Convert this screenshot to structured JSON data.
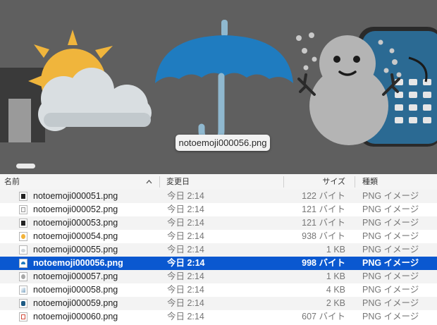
{
  "preview": {
    "caption": "notoemoji000056.png"
  },
  "columns": {
    "name": "名前",
    "date": "変更日",
    "size": "サイズ",
    "kind": "種類"
  },
  "files": [
    {
      "name": "notoemoji000051.png",
      "date": "今日 2:14",
      "size": "122 バイト",
      "kind": "PNG イメージ",
      "icon": "black-square-icon",
      "icon_color": "#222222"
    },
    {
      "name": "notoemoji000052.png",
      "date": "今日 2:14",
      "size": "121 バイト",
      "kind": "PNG イメージ",
      "icon": "white-square-icon",
      "icon_color": "#f4f4f4"
    },
    {
      "name": "notoemoji000053.png",
      "date": "今日 2:14",
      "size": "121 バイト",
      "kind": "PNG イメージ",
      "icon": "black-square-icon",
      "icon_color": "#222222"
    },
    {
      "name": "notoemoji000054.png",
      "date": "今日 2:14",
      "size": "938 バイト",
      "kind": "PNG イメージ",
      "icon": "sun-icon",
      "icon_color": "#f2b33a"
    },
    {
      "name": "notoemoji000055.png",
      "date": "今日 2:14",
      "size": "1 KB",
      "kind": "PNG イメージ",
      "icon": "cloud-icon",
      "icon_color": "#cfd6da"
    },
    {
      "name": "notoemoji000056.png",
      "date": "今日 2:14",
      "size": "998 バイト",
      "kind": "PNG イメージ",
      "icon": "umbrella-icon",
      "icon_color": "#1f7cc0",
      "selected": true
    },
    {
      "name": "notoemoji000057.png",
      "date": "今日 2:14",
      "size": "1 KB",
      "kind": "PNG イメージ",
      "icon": "snowman-icon",
      "icon_color": "#a8a8a8"
    },
    {
      "name": "notoemoji000058.png",
      "date": "今日 2:14",
      "size": "4 KB",
      "kind": "PNG イメージ",
      "icon": "comet-icon",
      "icon_color": "#7fa6c4"
    },
    {
      "name": "notoemoji000059.png",
      "date": "今日 2:14",
      "size": "2 KB",
      "kind": "PNG イメージ",
      "icon": "telephone-icon",
      "icon_color": "#1e5b84"
    },
    {
      "name": "notoemoji000060.png",
      "date": "今日 2:14",
      "size": "607 バイト",
      "kind": "PNG イメージ",
      "icon": "ballot-box-check-icon",
      "icon_color": "#d04a3a"
    }
  ]
}
